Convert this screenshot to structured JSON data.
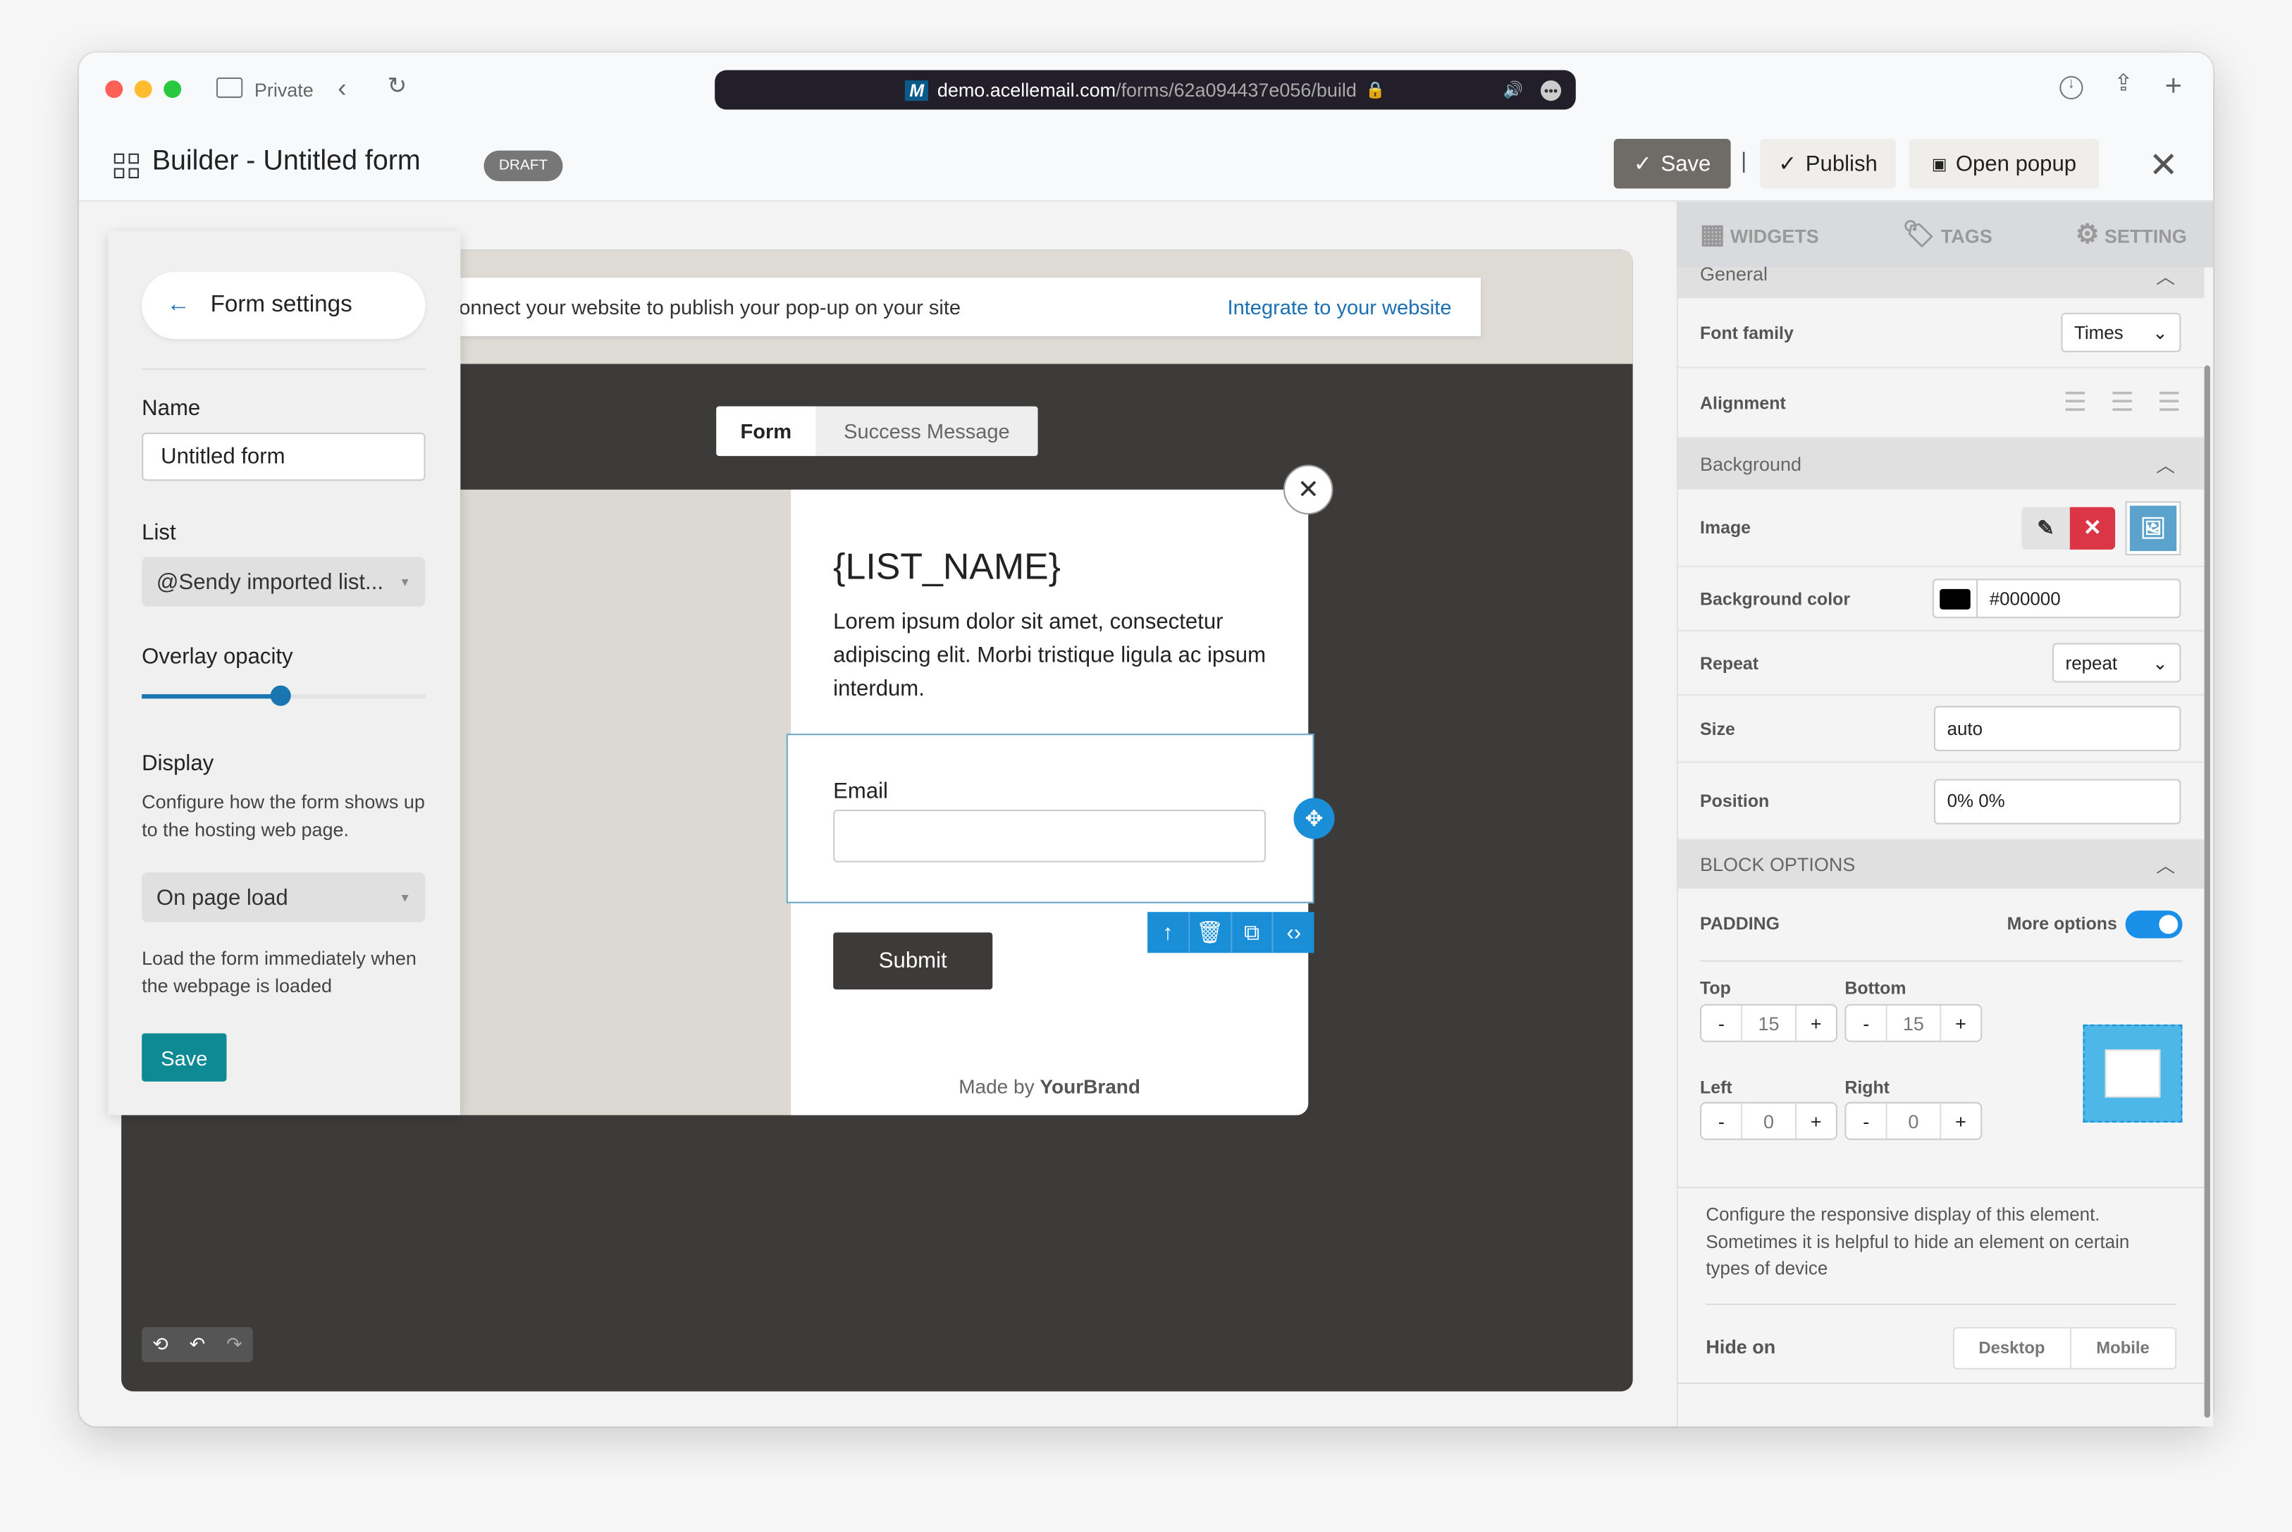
{
  "browser": {
    "private_label": "Private",
    "url_domain": "demo.acellemail.com",
    "url_path": "/forms/62a094437e056/build"
  },
  "header": {
    "title": "Builder - Untitled form",
    "badge": "DRAFT",
    "save": "Save",
    "separator": "|",
    "publish": "Publish",
    "open_popup": "Open popup"
  },
  "left_panel": {
    "back_title": "Form settings",
    "name_label": "Name",
    "name_value": "Untitled form",
    "list_label": "List",
    "list_value": "@Sendy imported list...",
    "overlay_label": "Overlay opacity",
    "overlay_value_fraction": 0.49,
    "display_label": "Display",
    "display_desc": "Configure how the form shows up to the hosting web page.",
    "display_value": "On page load",
    "display_value_desc": "Load the form immediately when the webpage is loaded",
    "save": "Save"
  },
  "canvas": {
    "notice": "onnect your website to publish your pop-up on your site",
    "integrate_link": "Integrate to your website",
    "tabs": [
      "Form",
      "Success Message"
    ],
    "popup": {
      "title": "{LIST_NAME}",
      "body": "Lorem ipsum dolor sit amet, consectetur adipiscing elit. Morbi tristique ligula ac ipsum interdum.",
      "email_label": "Email",
      "submit": "Submit",
      "made_by": "Made by",
      "brand": "YourBrand"
    }
  },
  "right_panel": {
    "tabs": [
      "WIDGETS",
      "TAGS",
      "SETTING"
    ],
    "general": "General",
    "font_family_label": "Font family",
    "font_family_value": "Times",
    "alignment_label": "Alignment",
    "background": "Background",
    "image_label": "Image",
    "bg_color_label": "Background color",
    "bg_color_value": "#000000",
    "repeat_label": "Repeat",
    "repeat_value": "repeat",
    "size_label": "Size",
    "size_value": "auto",
    "position_label": "Position",
    "position_value": "0% 0%",
    "block_options": "BLOCK OPTIONS",
    "padding": "PADDING",
    "more_options": "More options",
    "more_options_on": true,
    "top_label": "Top",
    "top_value": "15",
    "bottom_label": "Bottom",
    "bottom_value": "15",
    "left_label": "Left",
    "left_value": "0",
    "right_label": "Right",
    "right_value": "0",
    "minus": "-",
    "plus": "+",
    "responsive_desc": "Configure the responsive display of this element. Sometimes it is helpful to hide an element on certain types of device",
    "hide_on_label": "Hide on",
    "hide_on_options": [
      "Desktop",
      "Mobile"
    ]
  },
  "colors": {
    "accent": "#1a8fd8",
    "teal": "#0e8a94",
    "delete": "#dc3545",
    "link": "#1a6fb5"
  }
}
